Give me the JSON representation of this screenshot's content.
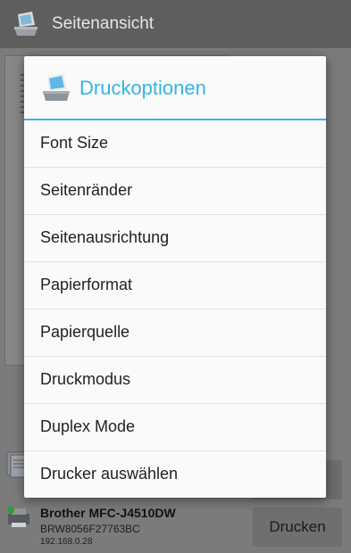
{
  "appbar": {
    "title": "Seitenansicht"
  },
  "bottom": {
    "print_label": "Drucken",
    "printer_name": "Brother MFC-J4510DW",
    "printer_id": "BRW8056F27763BC",
    "printer_ip": "192.168.0.28"
  },
  "dialog": {
    "title": "Druckoptionen",
    "items": [
      {
        "label": "Font Size"
      },
      {
        "label": "Seitenränder"
      },
      {
        "label": "Seitenausrichtung"
      },
      {
        "label": "Papierformat"
      },
      {
        "label": "Papierquelle"
      },
      {
        "label": "Druckmodus"
      },
      {
        "label": "Duplex Mode"
      },
      {
        "label": "Drucker auswählen"
      }
    ]
  },
  "colors": {
    "accent": "#33b5e5",
    "dim_overlay": "#7b7b7b"
  }
}
